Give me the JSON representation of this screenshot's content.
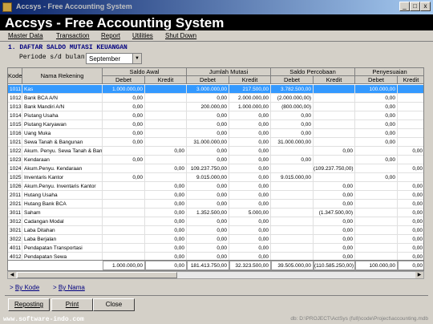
{
  "window": {
    "title": "Accsys - Free Accounting System",
    "min": "_",
    "max": "□",
    "close": "x"
  },
  "banner": {
    "title": "Accsys - Free Accounting System"
  },
  "menu": [
    "Master Data",
    "Transaction",
    "Report",
    "Utilities",
    "Shut Down"
  ],
  "section_title": "1. DAFTAR SALDO MUTASI KEUANGAN",
  "period": {
    "label": "Periode s/d bulan",
    "value": "September"
  },
  "headers": {
    "kode": "Kode",
    "nama": "Nama Rekening",
    "groups": [
      "Saldo Awal",
      "Jumlah Mutasi",
      "Saldo Percobaan",
      "Penyesuaian"
    ],
    "debet": "Debet",
    "kredit": "Kredit"
  },
  "rows": [
    [
      "1011",
      "Kas",
      "1.000.000,00",
      "",
      "3.000.000,00",
      "217.500,00",
      "3.782.500,00",
      "",
      "100.000,00",
      ""
    ],
    [
      "1012",
      "Bank BCA A/N",
      "0,00",
      "",
      "0,00",
      "2.000.000,00",
      "(2.000.000,00)",
      "",
      "0,00",
      ""
    ],
    [
      "1013",
      "Bank Mandiri A/N",
      "0,00",
      "",
      "200.000,00",
      "1.000.000,00",
      "(800.000,00)",
      "",
      "0,00",
      ""
    ],
    [
      "1014",
      "Piutang Usaha",
      "0,00",
      "",
      "0,00",
      "0,00",
      "0,00",
      "",
      "0,00",
      ""
    ],
    [
      "1015",
      "Piutang Karyawan",
      "0,00",
      "",
      "0,00",
      "0,00",
      "0,00",
      "",
      "0,00",
      ""
    ],
    [
      "1016",
      "Uang Muka",
      "0,00",
      "",
      "0,00",
      "0,00",
      "0,00",
      "",
      "0,00",
      ""
    ],
    [
      "1021",
      "Sewa Tanah & Bangunan",
      "0,00",
      "",
      "31.000.000,00",
      "0,00",
      "31.000.000,00",
      "",
      "0,00",
      ""
    ],
    [
      "1022",
      "Akum. Penyu. Sewa Tanah & Ban",
      "",
      "0,00",
      "0,00",
      "0,00",
      "",
      "0,00",
      "",
      "0,00"
    ],
    [
      "1023",
      "Kendaraan",
      "0,00",
      "",
      "0,00",
      "0,00",
      "0,00",
      "",
      "0,00",
      ""
    ],
    [
      "1024",
      "Akum.Penyu. Kendaraan",
      "",
      "0,00",
      "109.237.750,00",
      "0,00",
      "",
      "(109.237.750,00)",
      "",
      "0,00"
    ],
    [
      "1025",
      "Inventaris Kantor",
      "0,00",
      "",
      "9.015.000,00",
      "0,00",
      "9.015.000,00",
      "",
      "0,00",
      ""
    ],
    [
      "1026",
      "Akum.Penyu. Inventaris Kantor",
      "",
      "0,00",
      "0,00",
      "0,00",
      "",
      "0,00",
      "",
      "0,00"
    ],
    [
      "2011",
      "Hutang Usaha",
      "",
      "0,00",
      "0,00",
      "0,00",
      "",
      "0,00",
      "",
      "0,00"
    ],
    [
      "2021",
      "Hutang Bank BCA",
      "",
      "0,00",
      "0,00",
      "0,00",
      "",
      "0,00",
      "",
      "0,00"
    ],
    [
      "3011",
      "Saham",
      "",
      "0,00",
      "1.352.500,00",
      "5.000,00",
      "",
      "(1.347.500,00)",
      "",
      "0,00"
    ],
    [
      "3012",
      "Cadangan Modal",
      "",
      "0,00",
      "0,00",
      "0,00",
      "",
      "0,00",
      "",
      "0,00"
    ],
    [
      "3021",
      "Laba Ditahan",
      "",
      "0,00",
      "0,00",
      "0,00",
      "",
      "0,00",
      "",
      "0,00"
    ],
    [
      "3022",
      "Laba Berjalan",
      "",
      "0,00",
      "0,00",
      "0,00",
      "",
      "0,00",
      "",
      "0,00"
    ],
    [
      "4011",
      "Pendapatan Transportasi",
      "",
      "0,00",
      "0,00",
      "0,00",
      "",
      "0,00",
      "",
      "0,00"
    ],
    [
      "4012",
      "Pendapatan Sewa",
      "",
      "0,00",
      "0,00",
      "0,00",
      "",
      "0,00",
      "",
      "0,00"
    ]
  ],
  "totals": [
    "1.000.000,00",
    "0,00",
    "181.413.750,00",
    "32.323.500,00",
    "39.505.000,00",
    "(110.585.250,00)",
    "100.000,00",
    "0,00"
  ],
  "sort": {
    "by_kode": "By Kode",
    "by_nama": "By Nama"
  },
  "buttons": {
    "reposting": "Reposting",
    "print": "Print",
    "close": "Close"
  },
  "watermark": "www.software-indo.com",
  "dbpath": "db: D:\\PROJECT\\ActSys (full)\\code\\Project\\accounting.mdb"
}
